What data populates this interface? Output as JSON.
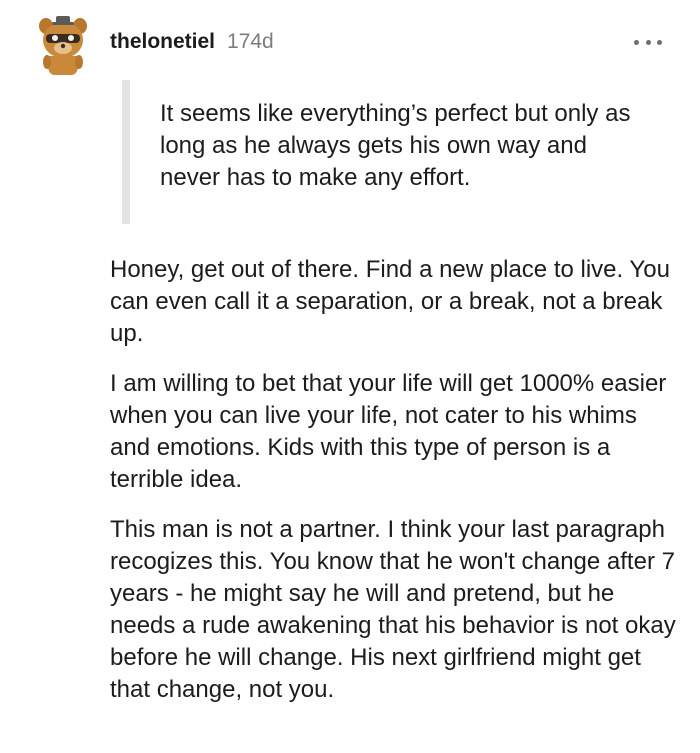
{
  "comment": {
    "username": "thelonetiel",
    "age": "174d",
    "avatar_icon": "snoo-avatar-icon",
    "quote": "It seems like everything’s perfect but only as long as he always gets his own way and never has to make any effort.",
    "paragraphs": [
      "Honey, get out of there. Find a new place to live. You can even call it a separation, or a break, not a break up.",
      "I am willing to bet that your life will get 1000% easier when you can live your life, not cater to his whims and emotions. Kids with this type of person is a terrible idea.",
      "This man is not a partner. I think your last paragraph recogizes this. You know that he won't change after 7 years - he might say he will and pretend, but he needs a rude awakening that his behavior is not okay before he will change. His next girlfriend might get that change, not you."
    ]
  },
  "colors": {
    "text": "#1c1c1c",
    "meta": "#7c7c7c",
    "quote_bar": "#e3e3e3",
    "avatar_fur": "#c9883a"
  }
}
